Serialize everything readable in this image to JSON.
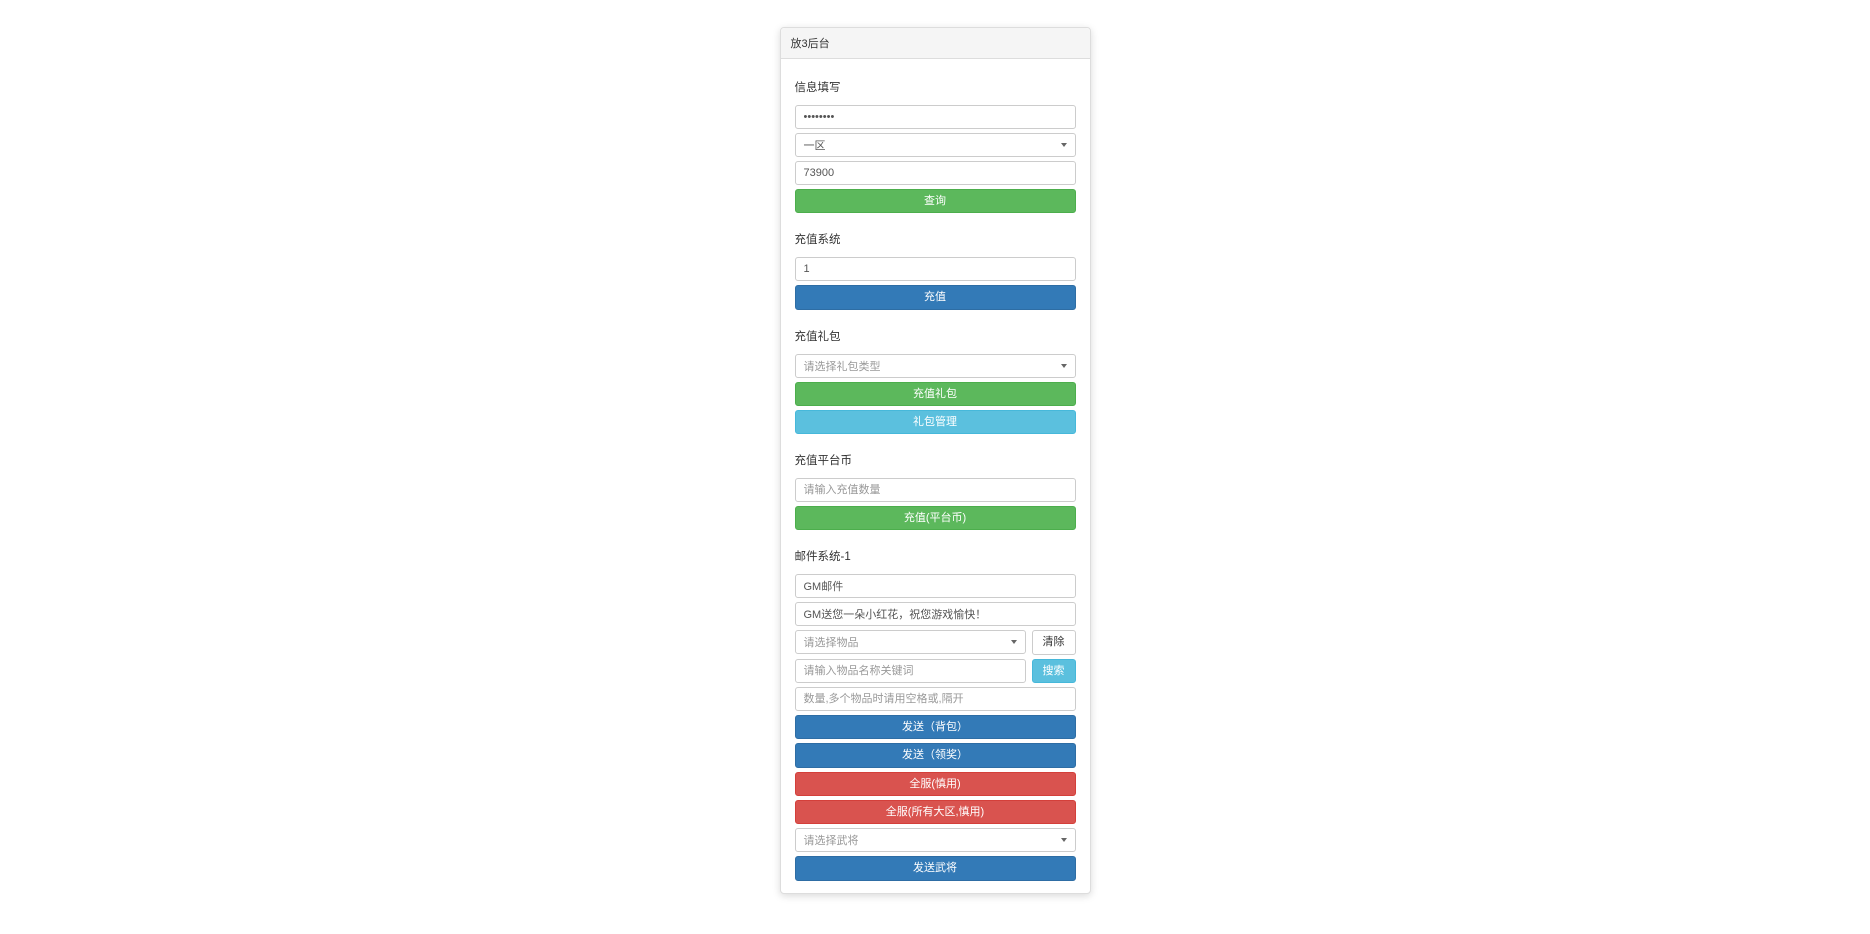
{
  "panel": {
    "title": "放3后台"
  },
  "info": {
    "label": "信息填写",
    "password_value": "••••••••",
    "zone_value": "一区",
    "account_value": "73900",
    "query_btn": "查询"
  },
  "recharge": {
    "label": "充值系统",
    "amount_value": "1",
    "btn": "充值"
  },
  "gift": {
    "label": "充值礼包",
    "select_placeholder": "请选择礼包类型",
    "btn_recharge": "充值礼包",
    "btn_manage": "礼包管理"
  },
  "platform": {
    "label": "充值平台币",
    "amount_placeholder": "请输入充值数量",
    "btn": "充值(平台币)"
  },
  "mail": {
    "label": "邮件系统-1",
    "title_value": "GM邮件",
    "content_value": "GM送您一朵小红花，祝您游戏愉快！",
    "item_select_placeholder": "请选择物品",
    "clear_btn": "清除",
    "keyword_placeholder": "请输入物品名称关键词",
    "search_btn": "搜索",
    "quantity_placeholder": "数量,多个物品时请用空格或,隔开",
    "send_bag_btn": "发送（背包）",
    "send_receive_btn": "发送（领奖）",
    "global_caution_btn": "全服(慎用)",
    "global_all_btn": "全服(所有大区,慎用)",
    "general_select_placeholder": "请选择武将",
    "send_general_btn": "发送武将"
  }
}
